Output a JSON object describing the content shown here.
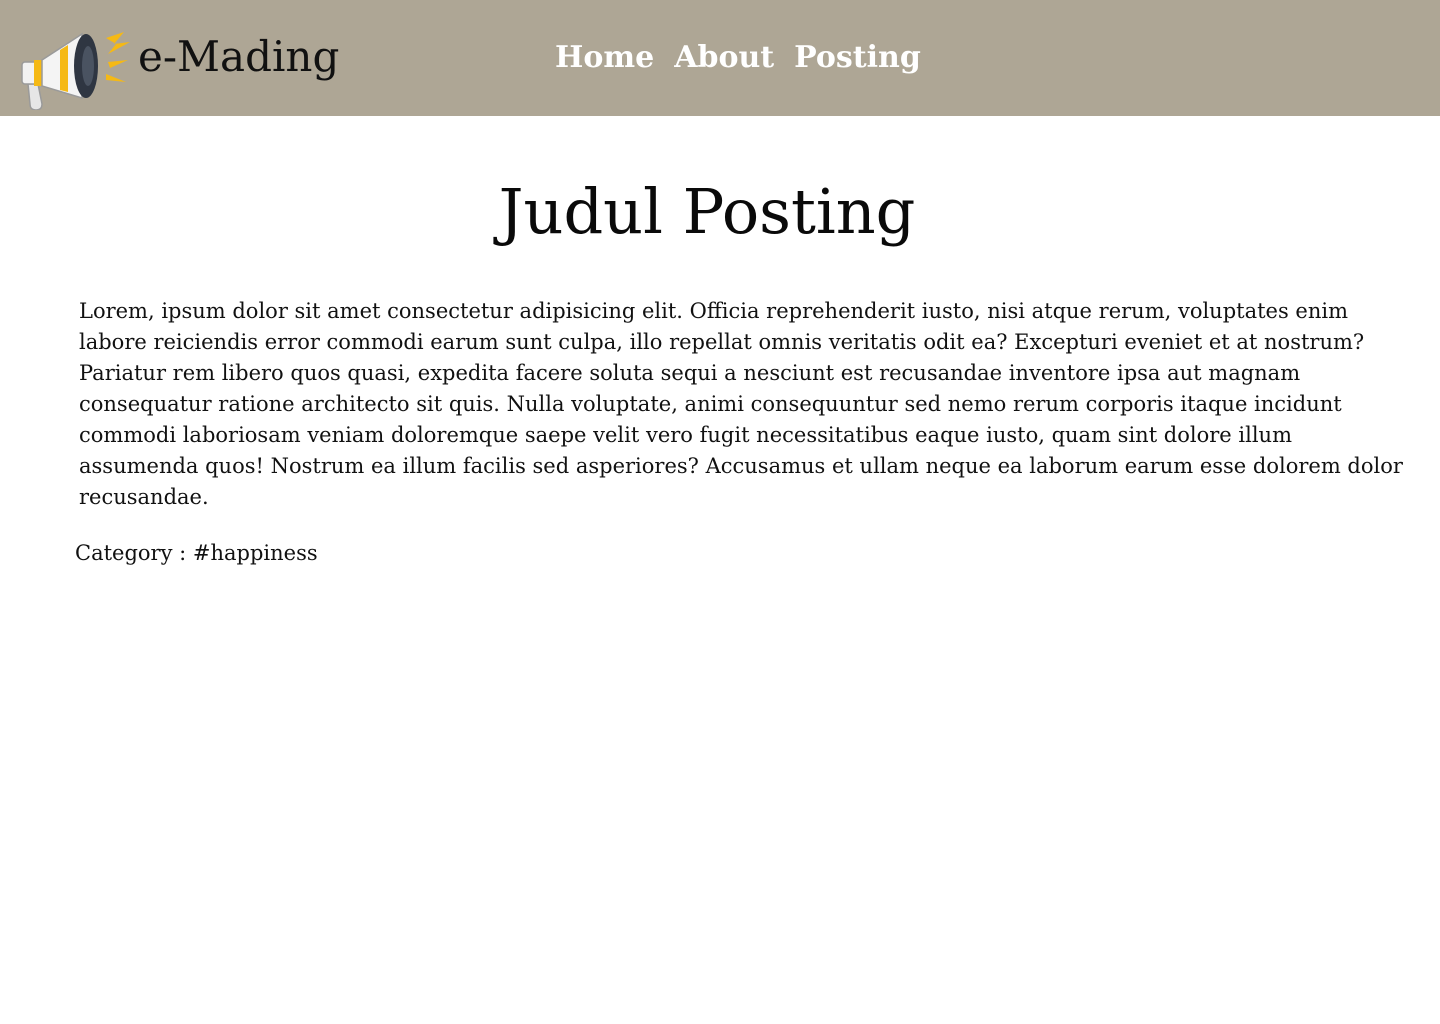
{
  "header": {
    "brand_name": "e-Mading",
    "logo_icon": "megaphone-icon",
    "background_color": "#aea695",
    "nav": [
      {
        "label": "Home"
      },
      {
        "label": "About"
      },
      {
        "label": "Posting"
      }
    ]
  },
  "post": {
    "title": "Judul Posting",
    "body": "Lorem, ipsum dolor sit amet consectetur adipisicing elit. Officia reprehenderit iusto, nisi atque rerum, voluptates enim labore reiciendis error commodi earum sunt culpa, illo repellat omnis veritatis odit ea? Excepturi eveniet et at nostrum? Pariatur rem libero quos quasi, expedita facere soluta sequi a nesciunt est recusandae inventore ipsa aut magnam consequatur ratione architecto sit quis. Nulla voluptate, animi consequuntur sed nemo rerum corporis itaque incidunt commodi laboriosam veniam doloremque saepe velit vero fugit necessitatibus eaque iusto, quam sint dolore illum assumenda quos! Nostrum ea illum facilis sed asperiores? Accusamus et ullam neque ea laborum earum esse dolorem dolor recusandae.",
    "category": "Category : #happiness"
  }
}
